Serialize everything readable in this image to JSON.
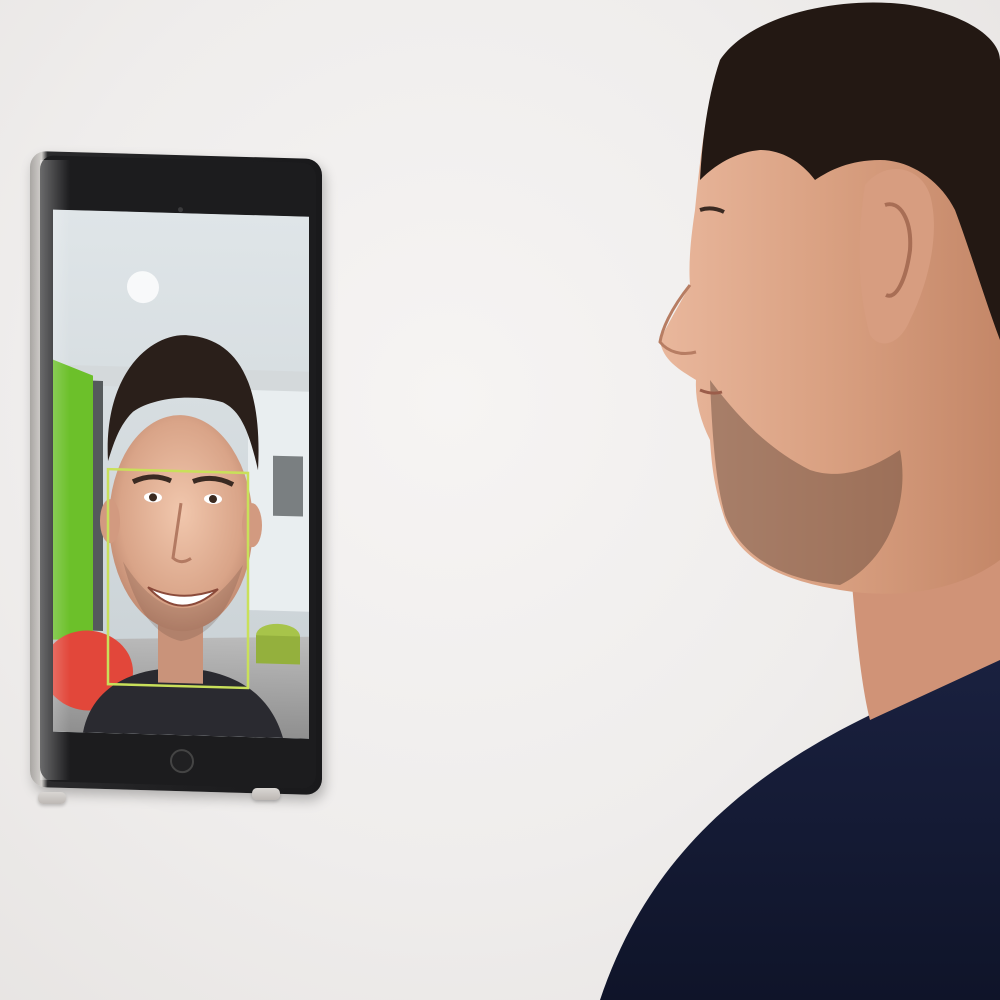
{
  "scene": {
    "description_icons": {
      "tablet": "tablet-device",
      "camera": "front-camera-icon",
      "home": "home-button-icon",
      "face_box": "face-detection-box"
    },
    "colors": {
      "wall": "#efedec",
      "tablet_frame": "#1c1c1e",
      "face_box": "#c9e05a",
      "shirt": "#141a33",
      "green_wall": "#6cc02a"
    }
  }
}
